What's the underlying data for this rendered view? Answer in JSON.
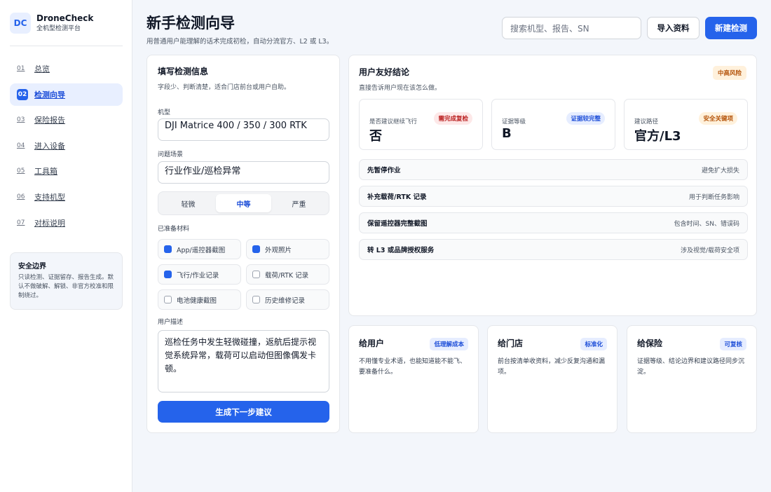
{
  "brand": {
    "logo": "DC",
    "name": "DroneCheck",
    "subtitle": "全机型检测平台"
  },
  "nav": [
    {
      "num": "01",
      "label": "总览"
    },
    {
      "num": "02",
      "label": "检测向导",
      "active": true
    },
    {
      "num": "03",
      "label": "保险报告"
    },
    {
      "num": "04",
      "label": "进入设备"
    },
    {
      "num": "05",
      "label": "工具箱"
    },
    {
      "num": "06",
      "label": "支持机型"
    },
    {
      "num": "07",
      "label": "对标说明"
    }
  ],
  "safety": {
    "title": "安全边界",
    "text": "只读检测、证据留存、报告生成。默认不做破解、解锁、非官方校准和限制绕过。"
  },
  "header": {
    "title": "新手检测向导",
    "subtitle": "用普通用户能理解的话术完成初检，自动分流官方、L2 或 L3。",
    "search_placeholder": "搜索机型、报告、SN",
    "import_label": "导入资料",
    "new_label": "新建检测"
  },
  "form": {
    "title": "填写检测信息",
    "subtitle": "字段少、判断清楚，适合门店前台或用户自助。",
    "model_label": "机型",
    "model_value": "DJI Matrice 400 / 350 / 300 RTK",
    "scene_label": "问题场景",
    "scene_value": "行业作业/巡检异常",
    "severity": [
      "轻微",
      "中等",
      "严重"
    ],
    "severity_selected": 1,
    "materials_label": "已准备材料",
    "materials": [
      {
        "label": "App/遥控器截图",
        "checked": true
      },
      {
        "label": "外观照片",
        "checked": true
      },
      {
        "label": "飞行/作业记录",
        "checked": true
      },
      {
        "label": "载荷/RTK 记录",
        "checked": false
      },
      {
        "label": "电池健康截图",
        "checked": false
      },
      {
        "label": "历史维修记录",
        "checked": false
      }
    ],
    "desc_label": "用户描述",
    "desc_value": "巡检任务中发生轻微碰撞，返航后提示视觉系统异常，载荷可以启动但图像偶发卡顿。",
    "submit_label": "生成下一步建议"
  },
  "result": {
    "title": "用户友好结论",
    "subtitle": "直接告诉用户现在该怎么做。",
    "risk": "中高风险",
    "kpis": [
      {
        "label": "是否建议继续飞行",
        "value": "否",
        "badge": "需完成复检",
        "tone": "red"
      },
      {
        "label": "证据等级",
        "value": "B",
        "badge": "证据较完整",
        "tone": "blue"
      },
      {
        "label": "建议路径",
        "value": "官方/L3",
        "badge": "安全关键项",
        "tone": "amber"
      }
    ],
    "steps": [
      {
        "name": "先暂停作业",
        "hint": "避免扩大损失"
      },
      {
        "name": "补充载荷/RTK 记录",
        "hint": "用于判断任务影响"
      },
      {
        "name": "保留遥控器完整截图",
        "hint": "包含时间、SN、错误码"
      },
      {
        "name": "转 L3 或品牌授权服务",
        "hint": "涉及视觉/载荷安全项"
      }
    ]
  },
  "audiences": [
    {
      "title": "给用户",
      "badge": "低理解成本",
      "text": "不用懂专业术语，也能知道能不能飞、要准备什么。"
    },
    {
      "title": "给门店",
      "badge": "标准化",
      "text": "前台按清单收资料，减少反复沟通和漏项。"
    },
    {
      "title": "给保险",
      "badge": "可复核",
      "text": "证据等级、结论边界和建议路径同步沉淀。"
    }
  ]
}
